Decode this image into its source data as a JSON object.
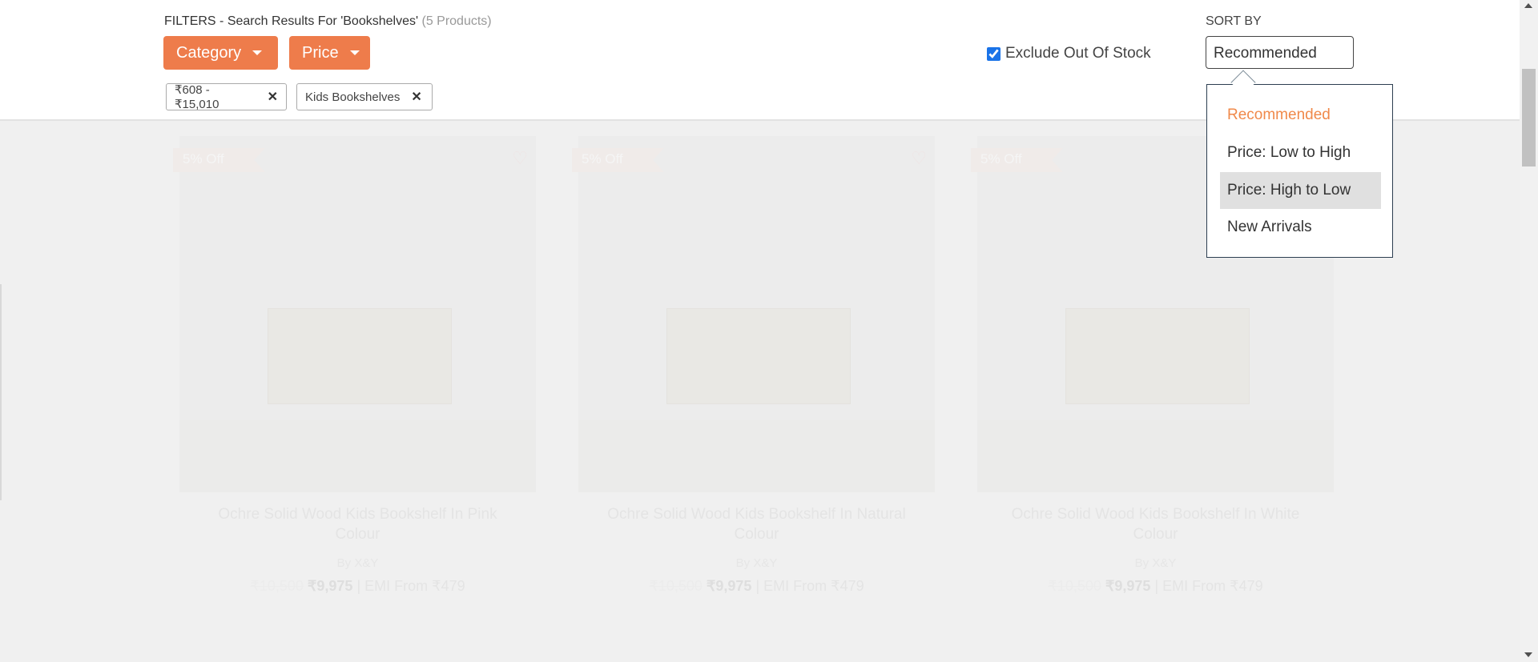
{
  "filters": {
    "title": "FILTERS - Search Results For 'Bookshelves'",
    "count": "(5 Products)",
    "category_label": "Category",
    "price_label": "Price",
    "chips": [
      "₹608 - ₹15,010",
      "Kids Bookshelves"
    ]
  },
  "exclude_out_of_stock": {
    "label": "Exclude Out Of Stock",
    "checked": true
  },
  "sort": {
    "label": "SORT BY",
    "selected": "Recommended",
    "options": [
      "Recommended",
      "Price: Low to High",
      "Price: High to Low",
      "New Arrivals"
    ],
    "hovered": "Price: High to Low"
  },
  "products": [
    {
      "badge": "5% Off",
      "title": "Ochre Solid Wood Kids Bookshelf In Pink Colour",
      "brand": "By X&Y",
      "mrp": "₹10,500",
      "price": "₹9,975",
      "emi": "| EMI From ₹479"
    },
    {
      "badge": "5% Off",
      "title": "Ochre Solid Wood Kids Bookshelf In Natural Colour",
      "brand": "By X&Y",
      "mrp": "₹10,500",
      "price": "₹9,975",
      "emi": "| EMI From ₹479"
    },
    {
      "badge": "5% Off",
      "title": "Ochre Solid Wood Kids Bookshelf In White Colour",
      "brand": "By X&Y",
      "mrp": "₹10,500",
      "price": "₹9,975",
      "emi": "| EMI From ₹479"
    }
  ],
  "colors": {
    "accent": "#ee7c4b",
    "active_option": "#f0894a"
  }
}
